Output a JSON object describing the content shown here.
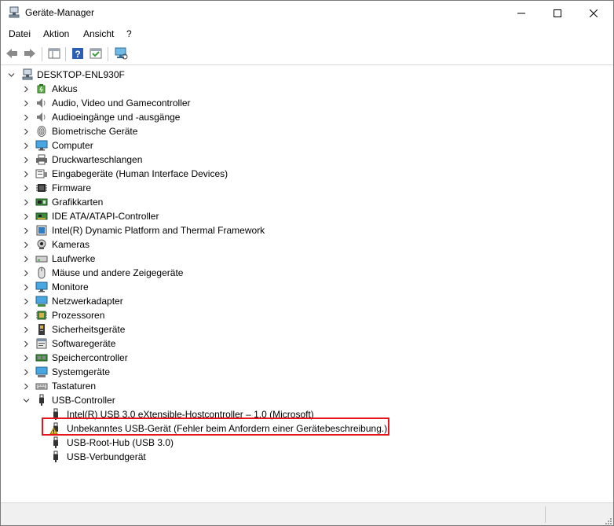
{
  "window": {
    "title": "Geräte-Manager"
  },
  "menu": [
    {
      "label": "Datei"
    },
    {
      "label": "Aktion"
    },
    {
      "label": "Ansicht"
    },
    {
      "label": "?"
    }
  ],
  "tree": {
    "root": "DESKTOP-ENL930F",
    "categories": [
      {
        "label": "Akkus",
        "icon": "battery-icon"
      },
      {
        "label": "Audio, Video und Gamecontroller",
        "icon": "speaker-icon"
      },
      {
        "label": "Audioeingänge und -ausgänge",
        "icon": "speaker-icon"
      },
      {
        "label": "Biometrische Geräte",
        "icon": "fingerprint-icon"
      },
      {
        "label": "Computer",
        "icon": "monitor-icon"
      },
      {
        "label": "Druckwarteschlangen",
        "icon": "printer-icon"
      },
      {
        "label": "Eingabegeräte (Human Interface Devices)",
        "icon": "hid-icon"
      },
      {
        "label": "Firmware",
        "icon": "chip-icon"
      },
      {
        "label": "Grafikkarten",
        "icon": "gpu-icon"
      },
      {
        "label": "IDE ATA/ATAPI-Controller",
        "icon": "ide-icon"
      },
      {
        "label": "Intel(R) Dynamic Platform and Thermal Framework",
        "icon": "device-icon"
      },
      {
        "label": "Kameras",
        "icon": "camera-icon"
      },
      {
        "label": "Laufwerke",
        "icon": "drive-icon"
      },
      {
        "label": "Mäuse und andere Zeigegeräte",
        "icon": "mouse-icon"
      },
      {
        "label": "Monitore",
        "icon": "monitor-icon"
      },
      {
        "label": "Netzwerkadapter",
        "icon": "network-icon"
      },
      {
        "label": "Prozessoren",
        "icon": "cpu-icon"
      },
      {
        "label": "Sicherheitsgeräte",
        "icon": "security-icon"
      },
      {
        "label": "Softwaregeräte",
        "icon": "software-device-icon"
      },
      {
        "label": "Speichercontroller",
        "icon": "storage-icon"
      },
      {
        "label": "Systemgeräte",
        "icon": "system-icon"
      },
      {
        "label": "Tastaturen",
        "icon": "keyboard-icon"
      }
    ],
    "usb": {
      "label": "USB-Controller",
      "children": [
        {
          "label": "Intel(R) USB 3.0 eXtensible-Hostcontroller – 1.0 (Microsoft)",
          "icon": "usb-plug-icon"
        },
        {
          "label": "Unbekanntes USB-Gerät (Fehler beim Anfordern einer Gerätebeschreibung.)",
          "icon": "usb-warning-icon"
        },
        {
          "label": "USB-Root-Hub (USB 3.0)",
          "icon": "usb-plug-icon"
        },
        {
          "label": "USB-Verbundgerät",
          "icon": "usb-plug-icon"
        }
      ]
    }
  },
  "colors": {
    "highlight_border": "#e8141c",
    "accent": "#2c7ed6"
  }
}
